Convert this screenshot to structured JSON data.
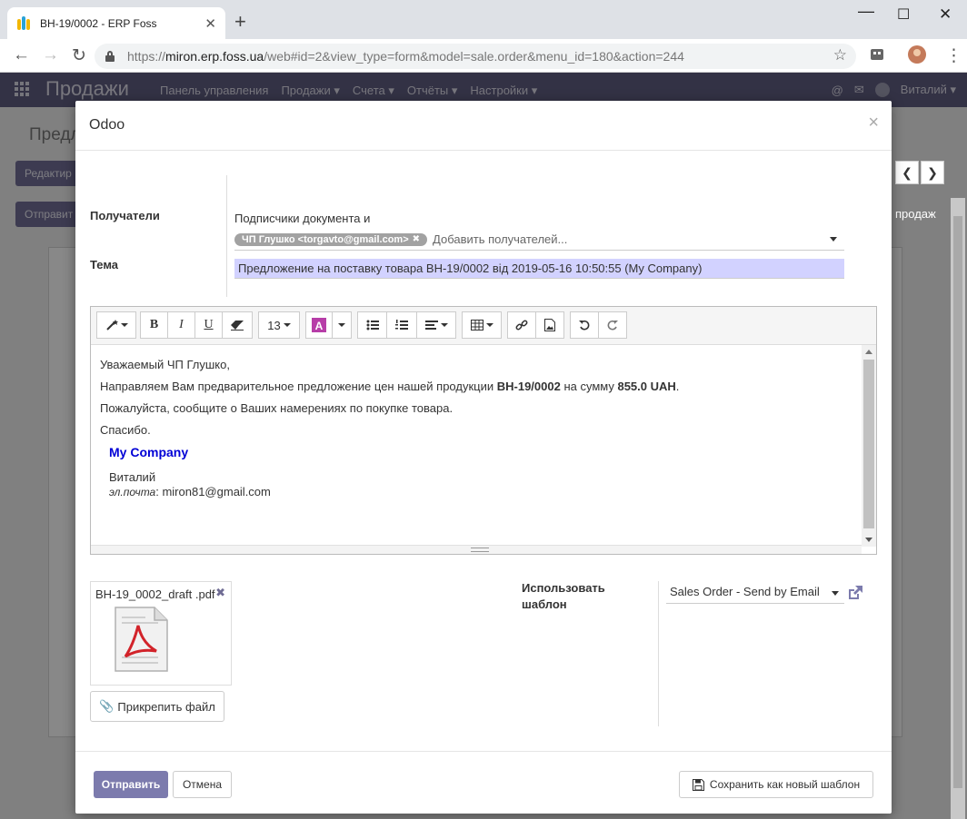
{
  "browser": {
    "tab_title": "ВН-19/0002 - ERP Foss",
    "tab_close": "✕",
    "new_tab": "+",
    "url_host": "miron.erp.foss.ua",
    "url_path": "/web#id=2&view_type=form&model=sale.order&menu_id=180&action=244",
    "url_scheme": "https://"
  },
  "odoo_nav": {
    "brand": "Продажи",
    "menu": [
      "Панель управления",
      "Продажи ▾",
      "Счета ▾",
      "Отчёты ▾",
      "Настройки ▾"
    ],
    "user": "Виталий ▾"
  },
  "background": {
    "title": "Предл",
    "edit_button": "Редактир",
    "send_button": "Отправит",
    "side_label": "продаж"
  },
  "modal": {
    "title": "Odoo",
    "close": "×",
    "recipients_label": "Получатели",
    "subscribers_text": "Подписчики документа и",
    "recipient_tag": "ЧП Глушко <torgavto@gmail.com>",
    "recipients_placeholder": "Добавить получателей...",
    "subject_label": "Тема",
    "subject_value": "Предложение на поставку товара ВН-19/0002 від 2019-05-16 10:50:55 (My Company)",
    "toolbar": {
      "font_size": "13",
      "bold": "B",
      "italic": "I",
      "underline": "U"
    },
    "body": {
      "greeting": "Уважаемый ЧП Глушко,",
      "line2_prefix": "Направляем Вам предварительное предложение цен нашей продукции ",
      "line2_order": "ВН-19/0002",
      "line2_mid": " на сумму ",
      "line2_amount": "855.0 UAH",
      "line2_suffix": ".",
      "line3": "Пожалуйста, сообщите о Ваших намерениях по покупке товара.",
      "line4": "Спасибо.",
      "signature_company": "My Company",
      "signature_name": "Виталий",
      "signature_email_label": "эл.почта",
      "signature_email": "miron81@gmail.com"
    },
    "attachment_name": "ВН-19_0002_draft .pdf",
    "attach_button": "Прикрепить файл",
    "template_label": "Использовать шаблон",
    "template_value": "Sales Order - Send by Email",
    "send_button": "Отправить",
    "cancel_button": "Отмена",
    "save_template_button": "Сохранить как новый шаблон"
  },
  "colors": {
    "odoo_primary": "#7c7bad",
    "subject_highlight": "#d2d2ff",
    "signature_company": "#0000d6"
  }
}
